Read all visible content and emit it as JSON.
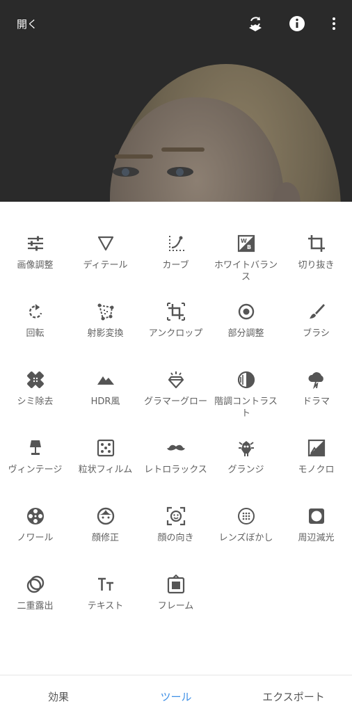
{
  "header": {
    "open_label": "開く",
    "icons": [
      "layers-undo-icon",
      "info-icon",
      "more-vert-icon"
    ]
  },
  "tools": [
    {
      "label": "画像調整",
      "icon": "tune-sliders-icon"
    },
    {
      "label": "ディテール",
      "icon": "triangle-down-icon"
    },
    {
      "label": "カーブ",
      "icon": "curve-icon"
    },
    {
      "label": "ホワイトバランス",
      "icon": "white-balance-icon"
    },
    {
      "label": "切り抜き",
      "icon": "crop-icon"
    },
    {
      "label": "回転",
      "icon": "rotate-icon"
    },
    {
      "label": "射影変換",
      "icon": "perspective-icon"
    },
    {
      "label": "アンクロップ",
      "icon": "expand-icon"
    },
    {
      "label": "部分調整",
      "icon": "selective-icon"
    },
    {
      "label": "ブラシ",
      "icon": "brush-icon"
    },
    {
      "label": "シミ除去",
      "icon": "healing-icon"
    },
    {
      "label": "HDR風",
      "icon": "mountains-icon"
    },
    {
      "label": "グラマーグロー",
      "icon": "diamond-glow-icon"
    },
    {
      "label": "階調コントラスト",
      "icon": "tonal-contrast-icon"
    },
    {
      "label": "ドラマ",
      "icon": "drama-cloud-icon"
    },
    {
      "label": "ヴィンテージ",
      "icon": "lamp-icon"
    },
    {
      "label": "粒状フィルム",
      "icon": "grain-dice-icon"
    },
    {
      "label": "レトロラックス",
      "icon": "mustache-icon"
    },
    {
      "label": "グランジ",
      "icon": "grunge-icon"
    },
    {
      "label": "モノクロ",
      "icon": "black-white-icon"
    },
    {
      "label": "ノワール",
      "icon": "film-reel-icon"
    },
    {
      "label": "顔修正",
      "icon": "face-icon"
    },
    {
      "label": "顔の向き",
      "icon": "face-pose-icon"
    },
    {
      "label": "レンズぼかし",
      "icon": "lens-blur-icon"
    },
    {
      "label": "周辺減光",
      "icon": "vignette-icon"
    },
    {
      "label": "二重露出",
      "icon": "double-exposure-icon"
    },
    {
      "label": "テキスト",
      "icon": "text-icon"
    },
    {
      "label": "フレーム",
      "icon": "frame-icon"
    }
  ],
  "nav": {
    "looks": "効果",
    "tools": "ツール",
    "export": "エクスポート"
  },
  "colors": {
    "accent": "#3d8fe6",
    "icon": "#555555"
  }
}
